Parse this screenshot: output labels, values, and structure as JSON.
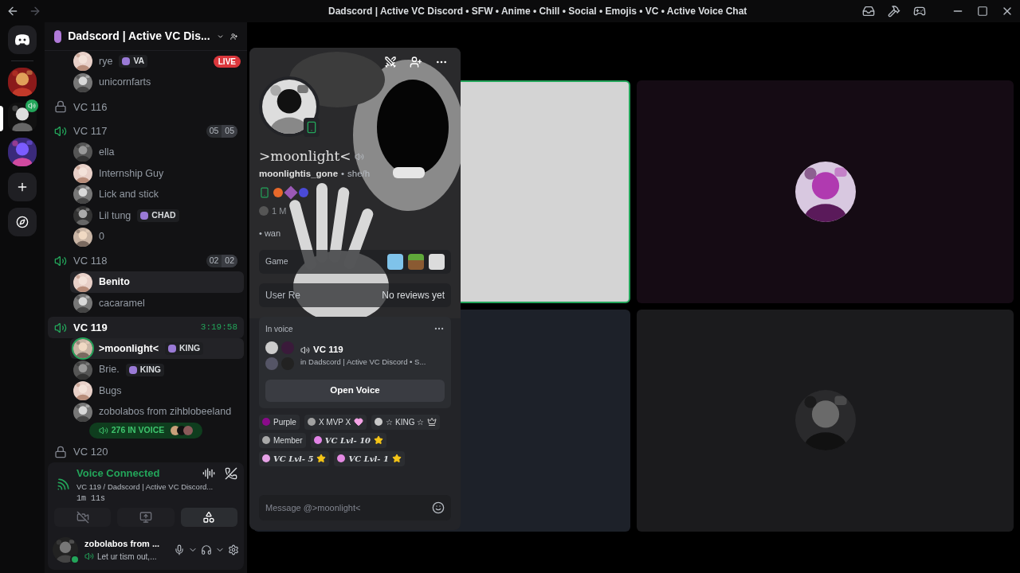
{
  "title_bar": {
    "title": "Dadscord | Active VC Discord • SFW • Anime • Chill • Social • Emojis • VC • Active Voice Chat"
  },
  "servers": [
    {
      "selected": false,
      "in_voice": false
    },
    {
      "selected": true,
      "in_voice": true
    },
    {
      "selected": false,
      "in_voice": false
    }
  ],
  "server_header": {
    "name": "Dadscord | Active VC Dis..."
  },
  "channel_rows": [
    {
      "kind": "member",
      "name": "rye",
      "tag": "VA",
      "live_badge": "LIVE",
      "selected": false,
      "speaking": false
    },
    {
      "kind": "member",
      "name": "unicornfarts",
      "selected": false,
      "speaking": false
    },
    {
      "kind": "channel",
      "name": "VC 116",
      "locked": true,
      "selected": false
    },
    {
      "kind": "channel",
      "name": "VC 117",
      "locked": false,
      "count": "05",
      "limit": "05",
      "selected": false
    },
    {
      "kind": "member",
      "name": "ella",
      "selected": false,
      "speaking": false
    },
    {
      "kind": "member",
      "name": "Internship Guy",
      "selected": false,
      "speaking": false
    },
    {
      "kind": "member",
      "name": "Lick and stick",
      "selected": false,
      "speaking": false
    },
    {
      "kind": "member",
      "name": "Lil tung",
      "tag": "CHAD",
      "selected": false,
      "speaking": false
    },
    {
      "kind": "member",
      "name": "0",
      "selected": false,
      "speaking": false
    },
    {
      "kind": "channel",
      "name": "VC 118",
      "locked": false,
      "count": "02",
      "limit": "02",
      "selected": false
    },
    {
      "kind": "member",
      "name": "Benito",
      "selected": true,
      "speaking": false
    },
    {
      "kind": "member",
      "name": "cacaramel",
      "selected": false,
      "speaking": false
    },
    {
      "kind": "channel",
      "name": "VC 119",
      "locked": false,
      "timer": "3:19:58",
      "selected": true
    },
    {
      "kind": "member",
      "name": ">moonlight<",
      "tag": "KING",
      "selected": true,
      "speaking": true
    },
    {
      "kind": "member",
      "name": "Brie.",
      "tag": "KING",
      "selected": false,
      "speaking": false
    },
    {
      "kind": "member",
      "name": "Bugs",
      "selected": false,
      "speaking": false
    },
    {
      "kind": "member",
      "name": "zobolabos from zihblobeeland",
      "selected": false,
      "speaking": false
    },
    {
      "kind": "channel",
      "name": "VC 120",
      "locked": true,
      "selected": false
    }
  ],
  "jump_pill": {
    "label": "276 IN VOICE"
  },
  "voice_panel": {
    "status": "Voice Connected",
    "channel": "VC 119 / Dadscord | Active VC Discord...",
    "elapsed": "1m 11s",
    "actions": [
      {
        "kind": "camera",
        "selected": false
      },
      {
        "kind": "screen",
        "selected": false
      },
      {
        "kind": "activity",
        "selected": true
      }
    ]
  },
  "user_panel": {
    "name": "zobolabos from ...",
    "status": "Let ur tism out,..."
  },
  "video_tiles": [
    {
      "kind": "blank",
      "speaking": true,
      "color": "#d4d4d4"
    },
    {
      "kind": "avatar",
      "speaking": false,
      "color": "#150b14"
    },
    {
      "kind": "blank",
      "speaking": false,
      "color": "#1d2129"
    },
    {
      "kind": "avatar",
      "speaking": false,
      "color": "#1b1b1d"
    }
  ],
  "profile": {
    "display_name": ">moonlight<",
    "username": "moonlightis_gone",
    "separator": "•",
    "pronouns": "she/h",
    "mutual": "1 M",
    "bio": "• wan",
    "games_label": "Game",
    "reviews_label": "User Re",
    "reviews_value": "No reviews yet",
    "voice": {
      "label": "In voice",
      "channel": "VC 119",
      "server": "in Dadscord | Active VC Discord • S..."
    },
    "open_button": "Open Voice",
    "roles": [
      {
        "name": "Purple",
        "color": "#8a0a8a",
        "kind": "plain"
      },
      {
        "name": "X MVP X",
        "color": "#a1a1a1",
        "kind": "heart"
      },
      {
        "name": "☆ KING ☆",
        "color": "#c8c8c8",
        "kind": "crown"
      },
      {
        "name": "Member",
        "color": "#a8a8a8",
        "kind": "plain"
      },
      {
        "name": "VC Lvl- 10",
        "color": "#e283e6",
        "kind": "star"
      },
      {
        "name": "VC Lvl- 5",
        "color": "#e6a2e6",
        "kind": "star"
      },
      {
        "name": "VC Lvl- 1",
        "color": "#e489e2",
        "kind": "star"
      }
    ],
    "message_placeholder": "Message @>moonlight<"
  }
}
